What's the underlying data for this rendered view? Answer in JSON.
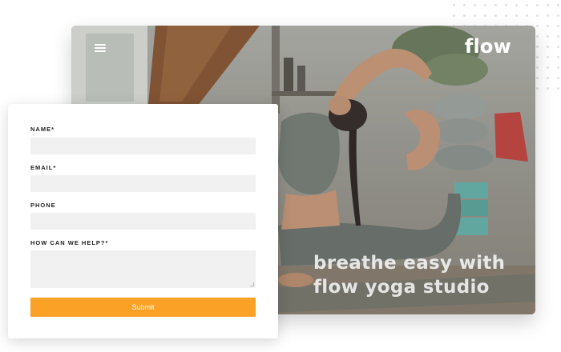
{
  "hero": {
    "logo_text": "flow",
    "tagline_line1": "breathe easy with",
    "tagline_line2": "flow yoga studio"
  },
  "form": {
    "name_label": "NAME*",
    "email_label": "EMAIL*",
    "phone_label": "PHONE",
    "help_label": "HOW CAN WE HELP?*",
    "name_value": "",
    "email_value": "",
    "phone_value": "",
    "help_value": "",
    "submit_label": "Submit"
  },
  "colors": {
    "accent": "#fba226",
    "field_bg": "#f1f1f1",
    "text_dark": "#222222"
  },
  "icons": {
    "menu": "hamburger-menu-icon"
  }
}
